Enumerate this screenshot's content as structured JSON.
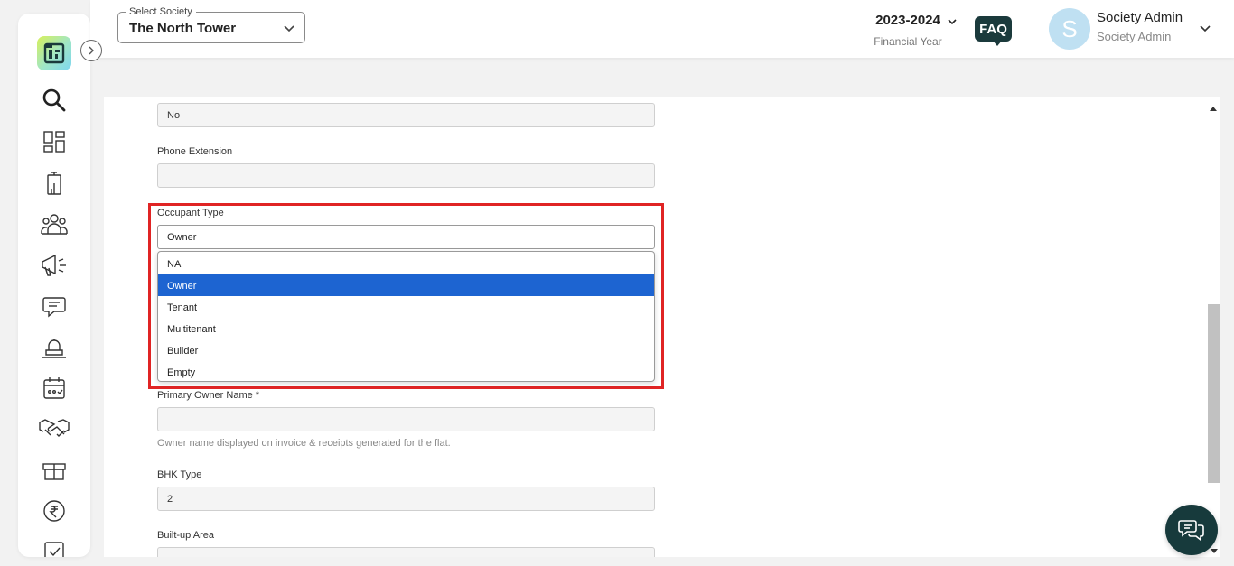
{
  "header": {
    "society_legend": "Select Society",
    "society_value": "The North Tower",
    "financial_year": "2023-2024",
    "financial_year_label": "Financial Year",
    "faq_label": "FAQ",
    "avatar_initial": "S",
    "user_name": "Society Admin",
    "user_role": "Society Admin"
  },
  "sidebar": {
    "items": [
      "search-icon",
      "dashboard-icon",
      "building-icon",
      "members-icon",
      "announcement-icon",
      "chat-icon",
      "facility-icon",
      "calendar-icon",
      "handshake-icon",
      "gift-icon",
      "rupee-icon",
      "tasks-icon"
    ]
  },
  "form": {
    "top_value": "No",
    "phone_extension_label": "Phone Extension",
    "phone_extension_value": "",
    "occupant_type_label": "Occupant Type",
    "occupant_type_value": "Owner",
    "occupant_options": [
      "NA",
      "Owner",
      "Tenant",
      "Multitenant",
      "Builder",
      "Empty"
    ],
    "occupant_selected_index": 1,
    "primary_owner_label": "Primary Owner Name *",
    "primary_owner_value": "",
    "primary_owner_helper": "Owner name displayed on invoice & receipts generated for the flat.",
    "bhk_label": "BHK Type",
    "bhk_value": "2",
    "builtup_label": "Built-up Area"
  },
  "colors": {
    "highlight": "#e02424",
    "selected_option": "#1d64d1",
    "faq_bg": "#1b3a3c",
    "avatar_bg": "#bfe0f2"
  }
}
